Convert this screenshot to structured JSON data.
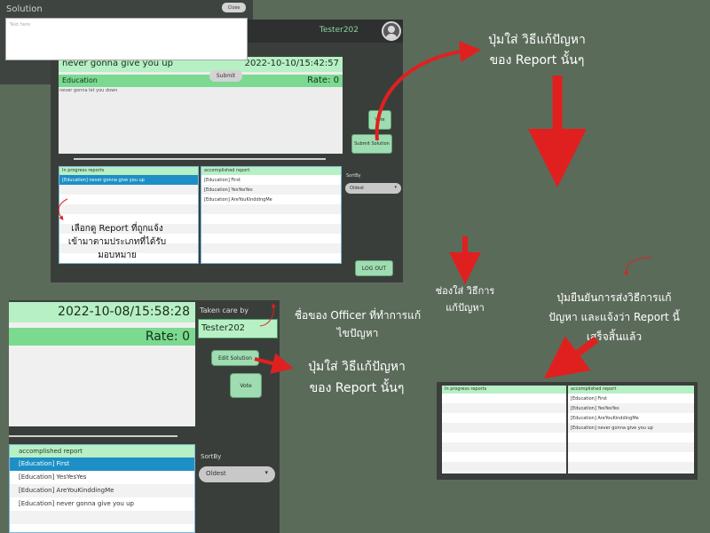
{
  "panelA": {
    "username": "Tester202",
    "report": {
      "title": "never gonna give you up",
      "datetime": "2022-10-10/15:42:57",
      "category": "Education",
      "rate": "Rate: 0",
      "body": "never gonna let you down"
    },
    "vote_label": "Vote",
    "submit_label": "Submit Solution",
    "in_progress": {
      "header": "In progress reports",
      "rows": [
        "[Education] never gonna give you up",
        "",
        "",
        "",
        "",
        "",
        "",
        "",
        "",
        ""
      ]
    },
    "accomplished": {
      "header": "accomplished report",
      "rows": [
        "[Education] First",
        "[Education] YesYesYes",
        "[Education] AreYouKinddingMe",
        "",
        "",
        "",
        "",
        "",
        ""
      ]
    },
    "sort_label": "SortBy",
    "sort_value": "Oldest",
    "logout_label": "LOG OUT"
  },
  "panelB": {
    "title": "Solution",
    "close_label": "Close",
    "placeholder": "Text here",
    "submit_label": "Submit"
  },
  "panelC": {
    "in_progress_header": "In progress reports",
    "accomplished_header": "accomplished report",
    "accomplished_rows": [
      "[Education] First",
      "[Education] YesYesYes",
      "[Education] AreYouKinddingMe",
      "[Education] never gonna give you up",
      "",
      "",
      "",
      ""
    ],
    "in_progress_rows": [
      "",
      "",
      "",
      "",
      "",
      "",
      "",
      ""
    ]
  },
  "panelD": {
    "datetime": "2022-10-08/15:58:28",
    "rate": "Rate: 0",
    "taken_care_label": "Taken care by",
    "taken_care_value": "Tester202",
    "edit_label": "Edit Solution",
    "vote_label": "Vote",
    "accomplished": {
      "header": "accomplished report",
      "rows": [
        "[Education] First",
        "[Education] YesYesYes",
        "[Education] AreYouKinddingMe",
        "[Education] never gonna give you up",
        "",
        ""
      ]
    },
    "sort_label": "SortBy",
    "sort_value": "Oldest"
  },
  "annotations": {
    "top_right_line1": "ปุ่มใส่ วิธีแก้ปัญหา",
    "top_right_line2": "ของ Report นั้นๆ",
    "select_line1": "เลือกดู Report ที่ถูกแจ้ง",
    "select_line2": "เข้ามาตามประเภทที่ได้รับ",
    "select_line3": "มอบหมาย",
    "field_line1": "ช่องใส่ วิธีการ",
    "field_line2": "แก้ปัญหา",
    "confirm_line1": "ปุ่มยืนยันการส่งวิธีการแก้",
    "confirm_line2": "ปัญหา และแจ้งว่า Report นี้",
    "confirm_line3": "เสร็จสิ้นแล้ว",
    "officer_line1": "ชื่อของ Officer ที่ทำการแก้",
    "officer_line2": "ไขปัญหา",
    "edit_line1": "ปุ่มใส่ วิธีแก้ปัญหา",
    "edit_line2": "ของ Report นั้นๆ"
  }
}
